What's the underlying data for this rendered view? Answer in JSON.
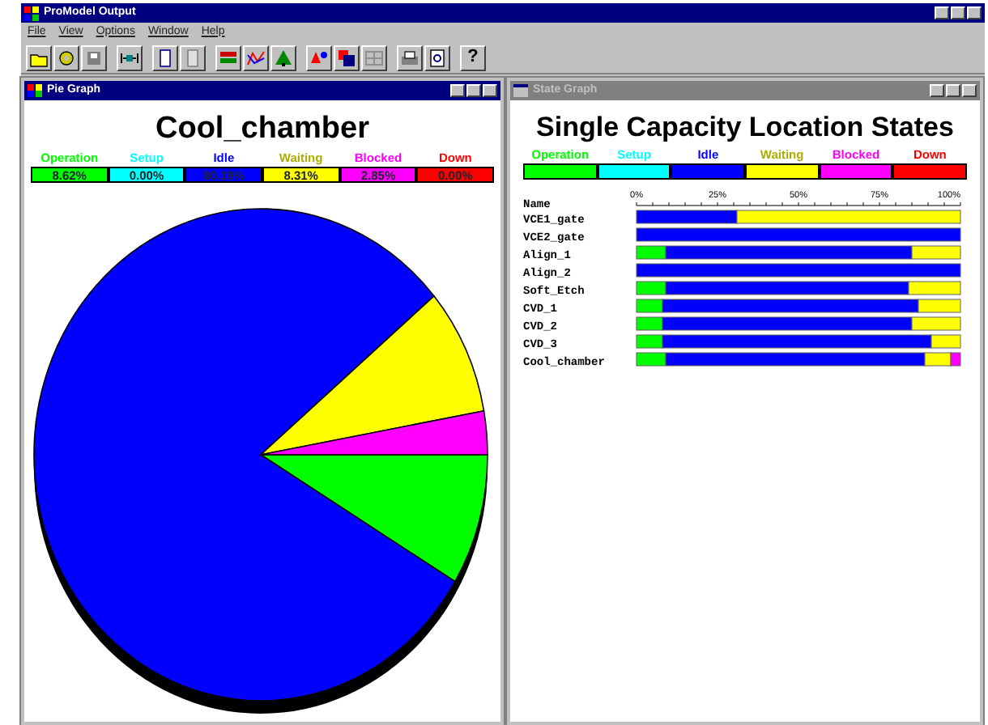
{
  "window": {
    "title": "ProModel Output"
  },
  "menu": [
    "File",
    "View",
    "Options",
    "Window",
    "Help"
  ],
  "toolbar": {
    "help_label": "?"
  },
  "pie_window": {
    "title": "Pie Graph",
    "active": true,
    "chart_title": "Cool_chamber",
    "legend_values": [
      "8.62%",
      "0.00%",
      "80.19%",
      "8.31%",
      "2.85%",
      "0.00%"
    ],
    "chart_data": {
      "type": "pie",
      "categories": [
        "Operation",
        "Setup",
        "Idle",
        "Waiting",
        "Blocked",
        "Down"
      ],
      "values": [
        8.62,
        0,
        80.19,
        8.31,
        2.85,
        0
      ],
      "colors": [
        "#00ff00",
        "#00ffff",
        "#0000ff",
        "#ffff00",
        "#ff00ff",
        "#ff0000"
      ]
    }
  },
  "state_window": {
    "title": "State Graph",
    "active": false,
    "chart_title": "Single Capacity Location States",
    "name_header": "Name",
    "chart_data": {
      "type": "bar",
      "orientation": "horizontal",
      "stacked": true,
      "categories": [
        "VCE1_gate",
        "VCE2_gate",
        "Align_1",
        "Align_2",
        "Soft_Etch",
        "CVD_1",
        "CVD_2",
        "CVD_3",
        "Cool_chamber"
      ],
      "xlim": [
        0,
        100
      ],
      "xticks": [
        {
          "value": 0,
          "label": "0%"
        },
        {
          "value": 25,
          "label": "25%"
        },
        {
          "value": 50,
          "label": "50%"
        },
        {
          "value": 75,
          "label": "75%"
        },
        {
          "value": 100,
          "label": "100%"
        }
      ],
      "series": [
        {
          "name": "Operation",
          "color": "#00ff00",
          "values": [
            0,
            0,
            9,
            0,
            9,
            8,
            8,
            8,
            9
          ]
        },
        {
          "name": "Setup",
          "color": "#00ffff",
          "values": [
            0,
            0,
            0,
            0,
            0,
            0,
            0,
            0,
            0
          ]
        },
        {
          "name": "Idle",
          "color": "#0000ff",
          "values": [
            31,
            100,
            76,
            100,
            75,
            79,
            77,
            83,
            80
          ]
        },
        {
          "name": "Waiting",
          "color": "#ffff00",
          "values": [
            69,
            0,
            15,
            0,
            16,
            13,
            15,
            9,
            8
          ]
        },
        {
          "name": "Blocked",
          "color": "#ff00ff",
          "values": [
            0,
            0,
            0,
            0,
            0,
            0,
            0,
            0,
            3
          ]
        },
        {
          "name": "Down",
          "color": "#ff0000",
          "values": [
            0,
            0,
            0,
            0,
            0,
            0,
            0,
            0,
            0
          ]
        }
      ]
    }
  }
}
